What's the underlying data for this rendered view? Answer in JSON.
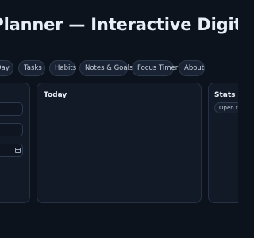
{
  "header": {
    "title": "s Planner — Interactive Digital P"
  },
  "nav": {
    "tabs": [
      {
        "label": "Day"
      },
      {
        "label": "Tasks"
      },
      {
        "label": "Habits"
      },
      {
        "label": "Notes & Goals"
      },
      {
        "label": "Focus Timer"
      },
      {
        "label": "About"
      }
    ]
  },
  "today": {
    "title": "Today"
  },
  "stats": {
    "title": "Stats",
    "chip_label": "Open tas"
  },
  "icons": {
    "date_field": "calendar-icon"
  }
}
